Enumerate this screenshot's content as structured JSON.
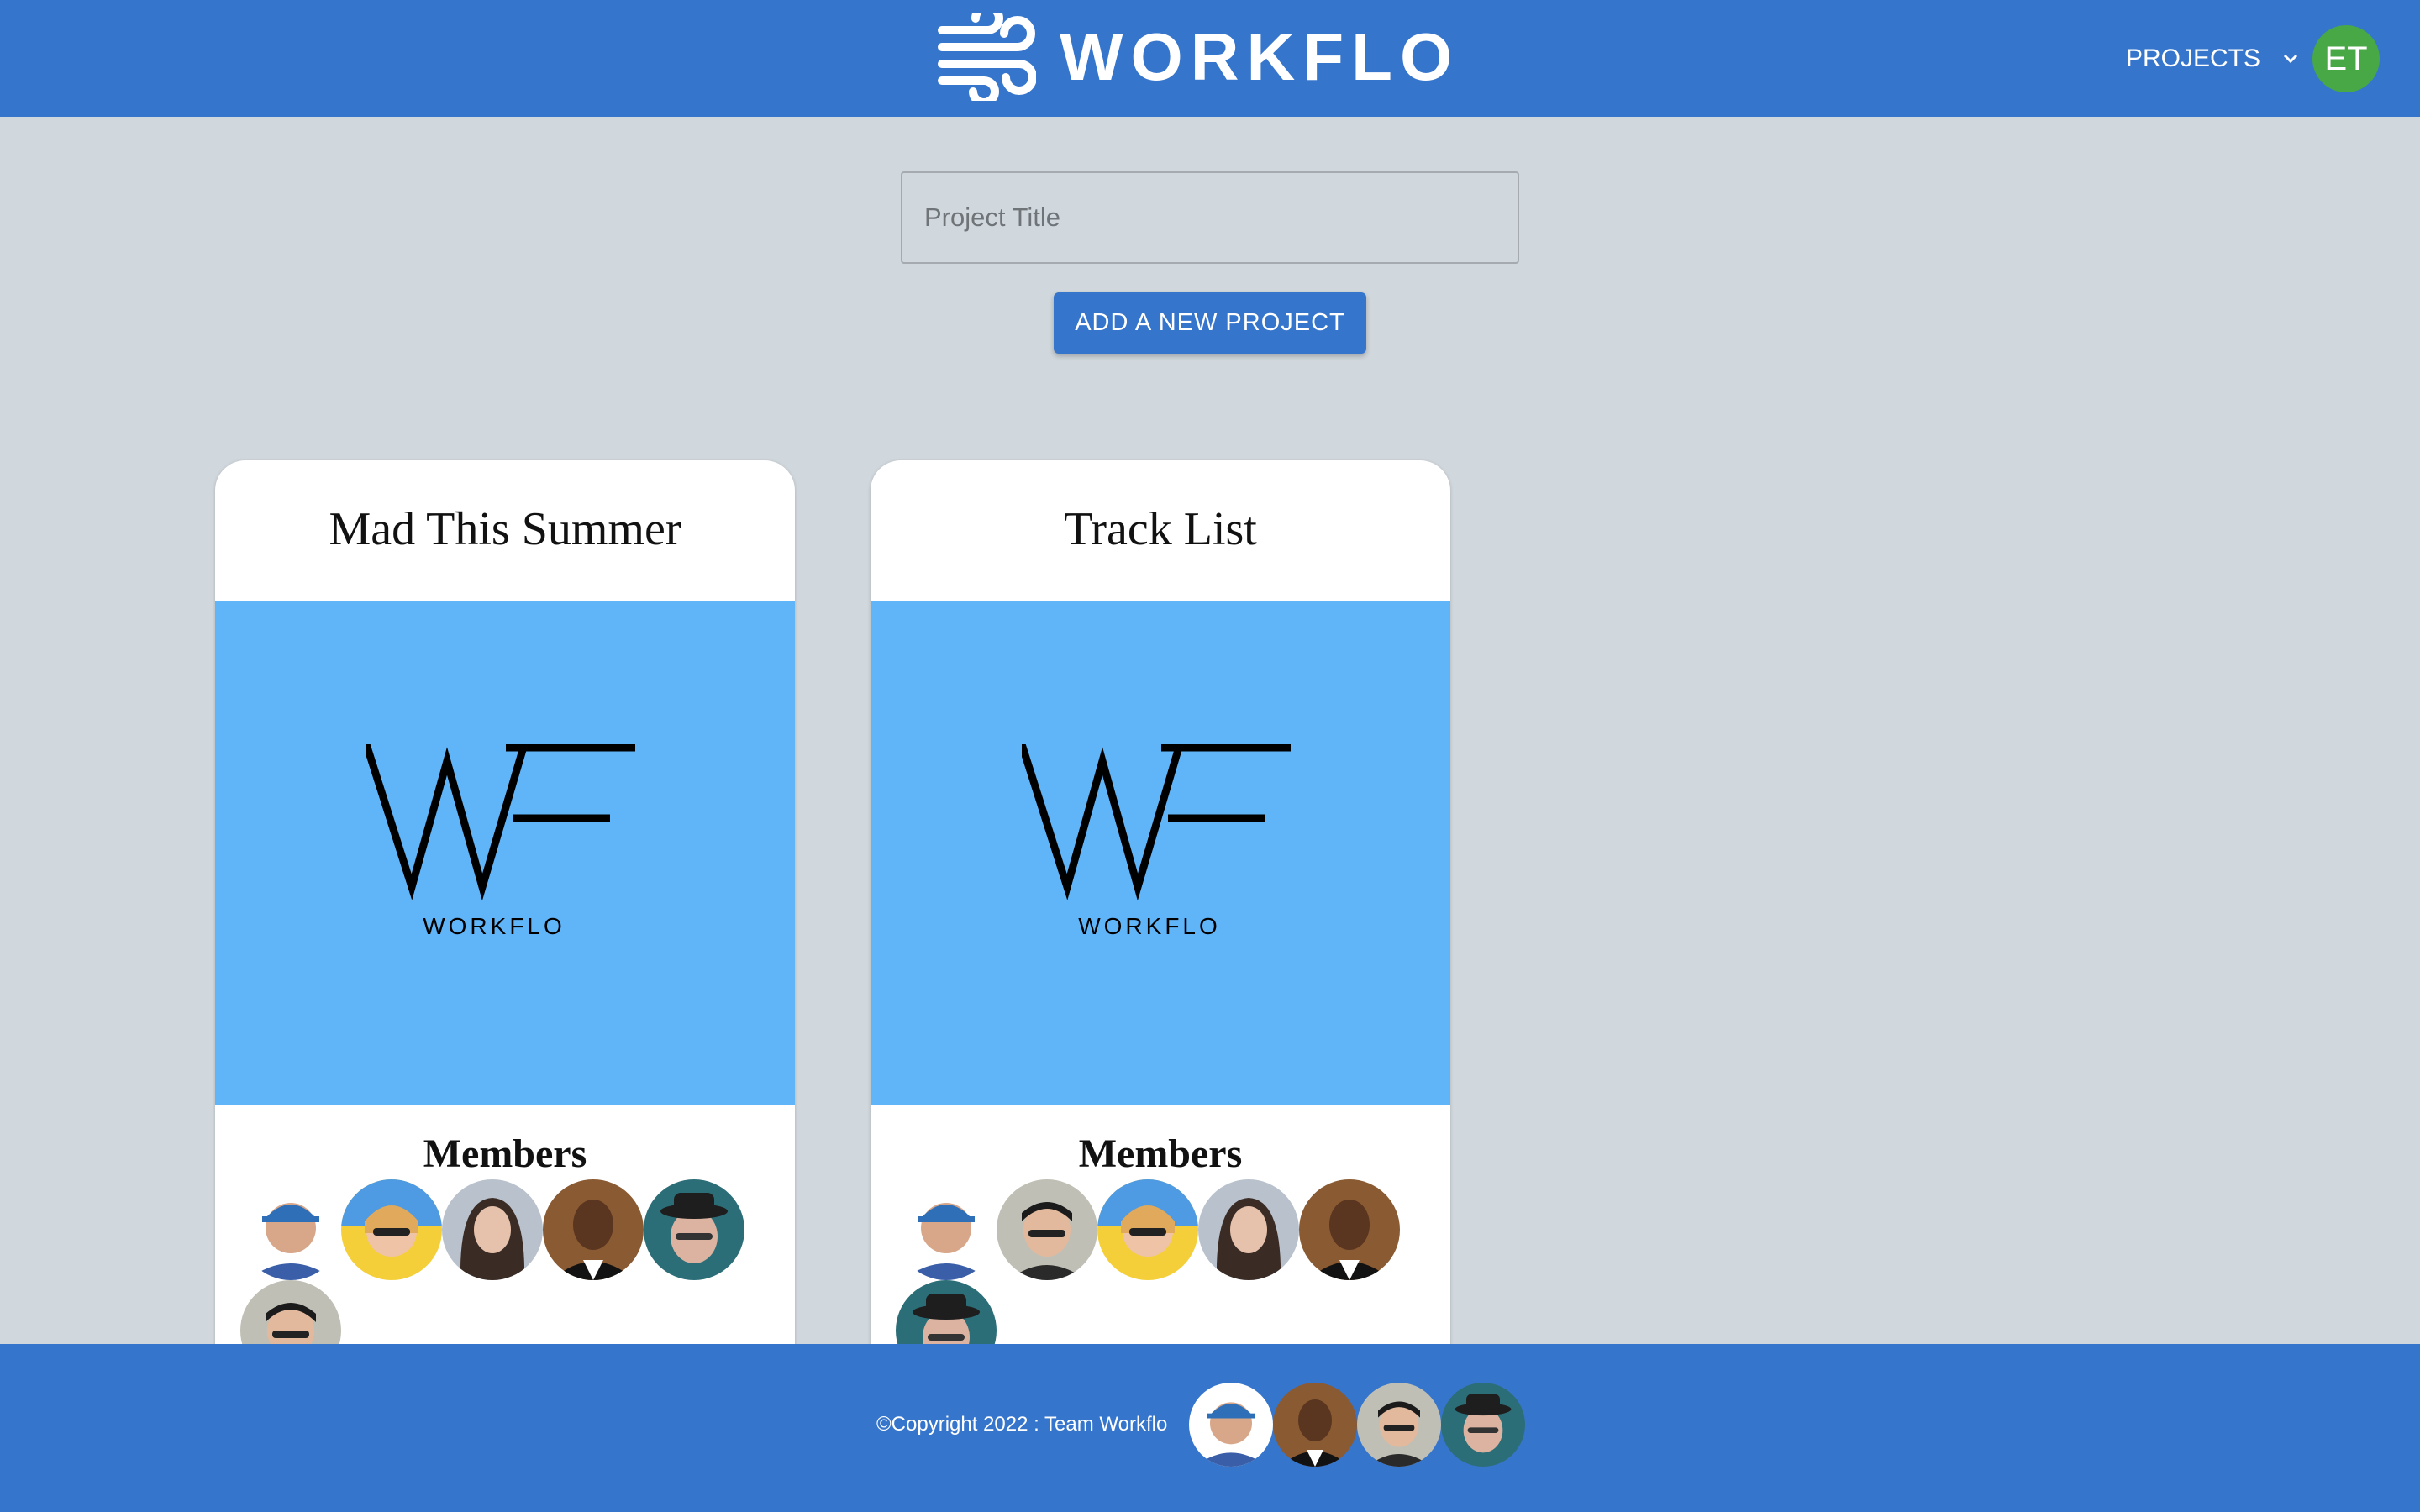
{
  "header": {
    "brand": "WORKFLO",
    "brand_icon": "wind-icon",
    "nav_projects": "PROJECTS",
    "user_initials": "ET",
    "avatar_color": "#47a845"
  },
  "new_project": {
    "title_placeholder": "Project Title",
    "title_value": "",
    "add_button": "ADD A NEW PROJECT"
  },
  "projects": [
    {
      "title": "Mad This Summer",
      "logo_wordmark": "WORKFLO",
      "members_heading": "Members",
      "member_count": 6
    },
    {
      "title": "Track List",
      "logo_wordmark": "WORKFLO",
      "members_heading": "Members",
      "member_count": 6
    }
  ],
  "footer": {
    "copyright": "©Copyright 2022 : Team Workflo",
    "team_avatar_count": 4
  },
  "colors": {
    "primary": "#3675cc",
    "background": "#d1d8dd",
    "card_image": "#60b4f8"
  }
}
